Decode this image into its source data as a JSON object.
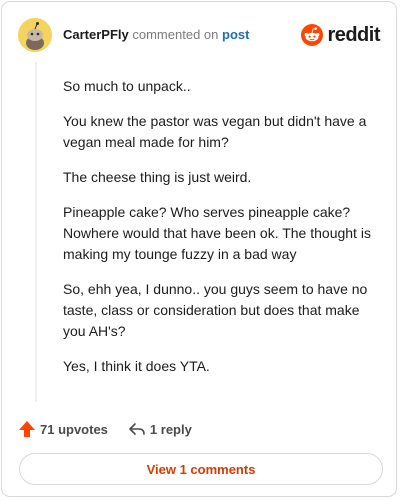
{
  "header": {
    "author": "CarterPFly",
    "commented_text": "commented on",
    "post_link": "post",
    "brand": "reddit"
  },
  "comment": {
    "paragraphs": [
      "So much to unpack..",
      "You knew the pastor was vegan but didn't have a vegan meal made for him?",
      "The cheese thing is just weird.",
      "Pineapple cake? Who serves pineapple cake? Nowhere would that have been ok. The thought is making my tounge fuzzy in a bad way",
      "So, ehh yea, I dunno.. you guys seem to have no taste, class or consideration but does that make you AH's?",
      "Yes, I think it does YTA."
    ]
  },
  "actions": {
    "upvotes": "71 upvotes",
    "replies": "1 reply"
  },
  "footer": {
    "view_comments": "View 1 comments"
  },
  "colors": {
    "upvote": "#ff4500",
    "brand": "#ff4500",
    "link": "#1c6fb8",
    "view_button": "#d93a00",
    "avatar_bg": "#f4d35e"
  }
}
